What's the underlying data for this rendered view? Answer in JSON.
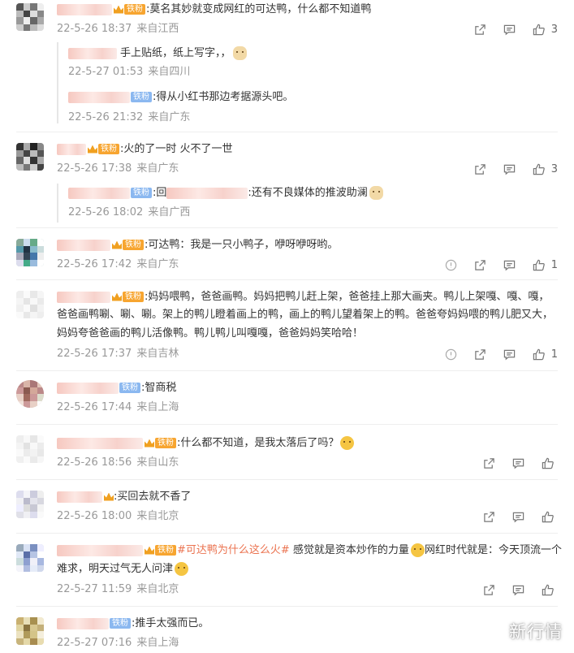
{
  "comments": [
    {
      "text": ":莫名其妙就变成网红的可达鸭，什么都不知道鸭",
      "time": "22-5-26 18:37",
      "location": "来自江西",
      "likes": "3"
    },
    {
      "text": "手上贴纸，纸上写字，，",
      "time": "22-5-27 01:53",
      "location": "来自四川"
    },
    {
      "badge": "铁粉",
      "text": ":得从小红书那边考据源头吧。",
      "time": "22-5-26 21:32",
      "location": "来自广东"
    },
    {
      "badge": "铁粉",
      "text": ":火的了一时 火不了一世",
      "time": "22-5-26 17:38",
      "location": "来自广东",
      "likes": "3"
    },
    {
      "badge": "铁粉",
      "prefix": ":回",
      "text": ":还有不良媒体的推波助澜",
      "time": "22-5-26 18:02",
      "location": "来自广西"
    },
    {
      "badge": "铁粉",
      "text": ":可达鸭：我是一只小鸭子，咿呀咿呀哟。",
      "time": "22-5-26 17:42",
      "location": "来自广东",
      "likes": "1"
    },
    {
      "badge": "铁粉",
      "lines": [
        ":妈妈喂鸭，爸爸画鸭。妈妈把鸭儿赶上架，爸爸挂上那大画夹。鸭儿上架嘎、嘎、嘎，",
        "爸爸画鸭唰、唰、唰。架上的鸭儿瞪着画上的鸭，画上的鸭儿望着架上的鸭。爸爸夸妈妈喂的鸭儿肥又大，",
        "妈妈夸爸爸画的鸭儿活像鸭。鸭儿鸭儿叫嘎嘎，爸爸妈妈笑哈哈！"
      ],
      "time": "22-5-26 17:37",
      "location": "来自吉林",
      "likes": "1"
    },
    {
      "badge": "铁粉",
      "text": ":智商税",
      "time": "22-5-26 17:44",
      "location": "来自上海"
    },
    {
      "badge": "铁粉",
      "text": ":什么都不知道，是我太落后了吗？",
      "time": "22-5-26 18:56",
      "location": "来自山东"
    },
    {
      "text": ":买回去就不香了",
      "time": "22-5-26 18:00",
      "location": "来自北京"
    },
    {
      "badge": "铁粉",
      "topic": "#可达鸭为什么这么火#",
      "text": " 感觉就是资本炒作的力量",
      "text2": "网红时代就是：今天顶流一个",
      "line2": "难求，明天过气无人问津",
      "time": "22-5-27 11:59",
      "location": "来自北京"
    },
    {
      "badge": "铁粉",
      "text": ":推手太强而已。",
      "time": "22-5-27 07:16",
      "location": "来自上海"
    }
  ],
  "watermark": "新行情",
  "icons": {
    "share": "share-icon",
    "comment": "comment-icon",
    "like": "like-icon",
    "report": "report-icon"
  },
  "colors": {
    "meta": "#999999",
    "badge_gold": "#f7a530",
    "badge_blue": "#8bb8f0",
    "topic": "#eb7350"
  }
}
